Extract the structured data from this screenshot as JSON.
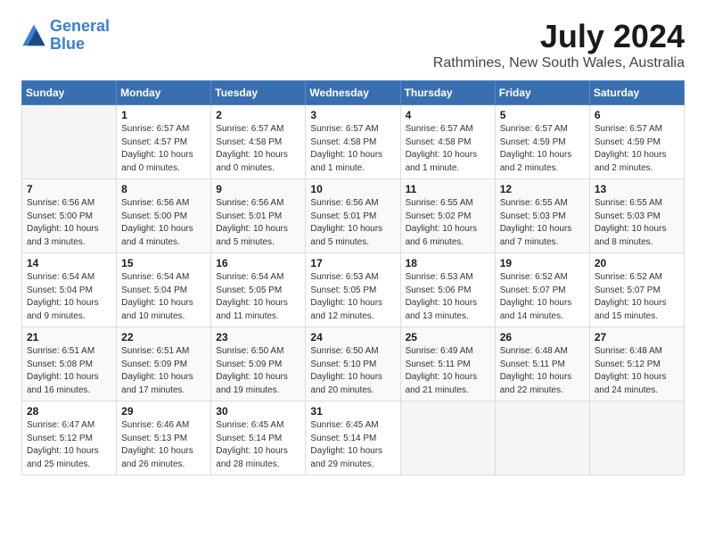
{
  "logo": {
    "line1": "General",
    "line2": "Blue"
  },
  "title": "July 2024",
  "location": "Rathmines, New South Wales, Australia",
  "days_of_week": [
    "Sunday",
    "Monday",
    "Tuesday",
    "Wednesday",
    "Thursday",
    "Friday",
    "Saturday"
  ],
  "weeks": [
    [
      {
        "day": "",
        "sunrise": "",
        "sunset": "",
        "daylight": ""
      },
      {
        "day": "1",
        "sunrise": "Sunrise: 6:57 AM",
        "sunset": "Sunset: 4:57 PM",
        "daylight": "Daylight: 10 hours and 0 minutes."
      },
      {
        "day": "2",
        "sunrise": "Sunrise: 6:57 AM",
        "sunset": "Sunset: 4:58 PM",
        "daylight": "Daylight: 10 hours and 0 minutes."
      },
      {
        "day": "3",
        "sunrise": "Sunrise: 6:57 AM",
        "sunset": "Sunset: 4:58 PM",
        "daylight": "Daylight: 10 hours and 1 minute."
      },
      {
        "day": "4",
        "sunrise": "Sunrise: 6:57 AM",
        "sunset": "Sunset: 4:58 PM",
        "daylight": "Daylight: 10 hours and 1 minute."
      },
      {
        "day": "5",
        "sunrise": "Sunrise: 6:57 AM",
        "sunset": "Sunset: 4:59 PM",
        "daylight": "Daylight: 10 hours and 2 minutes."
      },
      {
        "day": "6",
        "sunrise": "Sunrise: 6:57 AM",
        "sunset": "Sunset: 4:59 PM",
        "daylight": "Daylight: 10 hours and 2 minutes."
      }
    ],
    [
      {
        "day": "7",
        "sunrise": "Sunrise: 6:56 AM",
        "sunset": "Sunset: 5:00 PM",
        "daylight": "Daylight: 10 hours and 3 minutes."
      },
      {
        "day": "8",
        "sunrise": "Sunrise: 6:56 AM",
        "sunset": "Sunset: 5:00 PM",
        "daylight": "Daylight: 10 hours and 4 minutes."
      },
      {
        "day": "9",
        "sunrise": "Sunrise: 6:56 AM",
        "sunset": "Sunset: 5:01 PM",
        "daylight": "Daylight: 10 hours and 5 minutes."
      },
      {
        "day": "10",
        "sunrise": "Sunrise: 6:56 AM",
        "sunset": "Sunset: 5:01 PM",
        "daylight": "Daylight: 10 hours and 5 minutes."
      },
      {
        "day": "11",
        "sunrise": "Sunrise: 6:55 AM",
        "sunset": "Sunset: 5:02 PM",
        "daylight": "Daylight: 10 hours and 6 minutes."
      },
      {
        "day": "12",
        "sunrise": "Sunrise: 6:55 AM",
        "sunset": "Sunset: 5:03 PM",
        "daylight": "Daylight: 10 hours and 7 minutes."
      },
      {
        "day": "13",
        "sunrise": "Sunrise: 6:55 AM",
        "sunset": "Sunset: 5:03 PM",
        "daylight": "Daylight: 10 hours and 8 minutes."
      }
    ],
    [
      {
        "day": "14",
        "sunrise": "Sunrise: 6:54 AM",
        "sunset": "Sunset: 5:04 PM",
        "daylight": "Daylight: 10 hours and 9 minutes."
      },
      {
        "day": "15",
        "sunrise": "Sunrise: 6:54 AM",
        "sunset": "Sunset: 5:04 PM",
        "daylight": "Daylight: 10 hours and 10 minutes."
      },
      {
        "day": "16",
        "sunrise": "Sunrise: 6:54 AM",
        "sunset": "Sunset: 5:05 PM",
        "daylight": "Daylight: 10 hours and 11 minutes."
      },
      {
        "day": "17",
        "sunrise": "Sunrise: 6:53 AM",
        "sunset": "Sunset: 5:05 PM",
        "daylight": "Daylight: 10 hours and 12 minutes."
      },
      {
        "day": "18",
        "sunrise": "Sunrise: 6:53 AM",
        "sunset": "Sunset: 5:06 PM",
        "daylight": "Daylight: 10 hours and 13 minutes."
      },
      {
        "day": "19",
        "sunrise": "Sunrise: 6:52 AM",
        "sunset": "Sunset: 5:07 PM",
        "daylight": "Daylight: 10 hours and 14 minutes."
      },
      {
        "day": "20",
        "sunrise": "Sunrise: 6:52 AM",
        "sunset": "Sunset: 5:07 PM",
        "daylight": "Daylight: 10 hours and 15 minutes."
      }
    ],
    [
      {
        "day": "21",
        "sunrise": "Sunrise: 6:51 AM",
        "sunset": "Sunset: 5:08 PM",
        "daylight": "Daylight: 10 hours and 16 minutes."
      },
      {
        "day": "22",
        "sunrise": "Sunrise: 6:51 AM",
        "sunset": "Sunset: 5:09 PM",
        "daylight": "Daylight: 10 hours and 17 minutes."
      },
      {
        "day": "23",
        "sunrise": "Sunrise: 6:50 AM",
        "sunset": "Sunset: 5:09 PM",
        "daylight": "Daylight: 10 hours and 19 minutes."
      },
      {
        "day": "24",
        "sunrise": "Sunrise: 6:50 AM",
        "sunset": "Sunset: 5:10 PM",
        "daylight": "Daylight: 10 hours and 20 minutes."
      },
      {
        "day": "25",
        "sunrise": "Sunrise: 6:49 AM",
        "sunset": "Sunset: 5:11 PM",
        "daylight": "Daylight: 10 hours and 21 minutes."
      },
      {
        "day": "26",
        "sunrise": "Sunrise: 6:48 AM",
        "sunset": "Sunset: 5:11 PM",
        "daylight": "Daylight: 10 hours and 22 minutes."
      },
      {
        "day": "27",
        "sunrise": "Sunrise: 6:48 AM",
        "sunset": "Sunset: 5:12 PM",
        "daylight": "Daylight: 10 hours and 24 minutes."
      }
    ],
    [
      {
        "day": "28",
        "sunrise": "Sunrise: 6:47 AM",
        "sunset": "Sunset: 5:12 PM",
        "daylight": "Daylight: 10 hours and 25 minutes."
      },
      {
        "day": "29",
        "sunrise": "Sunrise: 6:46 AM",
        "sunset": "Sunset: 5:13 PM",
        "daylight": "Daylight: 10 hours and 26 minutes."
      },
      {
        "day": "30",
        "sunrise": "Sunrise: 6:45 AM",
        "sunset": "Sunset: 5:14 PM",
        "daylight": "Daylight: 10 hours and 28 minutes."
      },
      {
        "day": "31",
        "sunrise": "Sunrise: 6:45 AM",
        "sunset": "Sunset: 5:14 PM",
        "daylight": "Daylight: 10 hours and 29 minutes."
      },
      {
        "day": "",
        "sunrise": "",
        "sunset": "",
        "daylight": ""
      },
      {
        "day": "",
        "sunrise": "",
        "sunset": "",
        "daylight": ""
      },
      {
        "day": "",
        "sunrise": "",
        "sunset": "",
        "daylight": ""
      }
    ]
  ]
}
